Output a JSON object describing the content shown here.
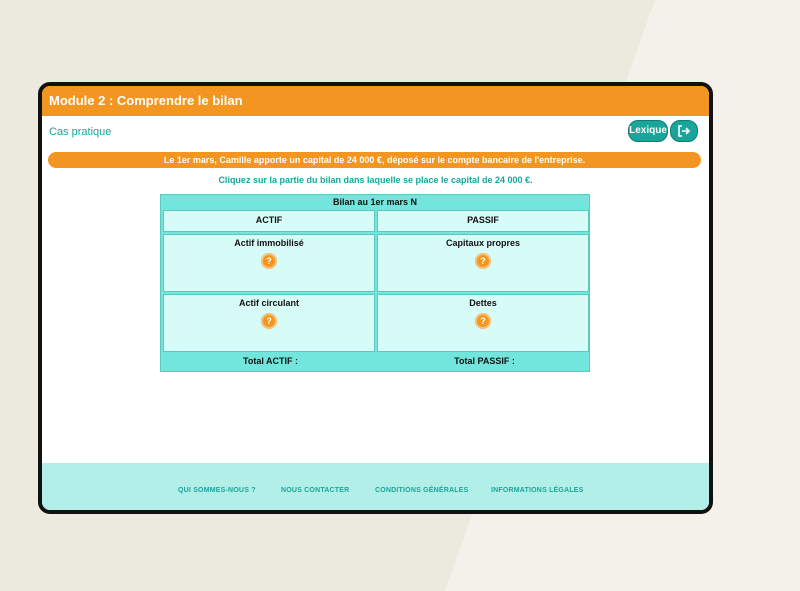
{
  "titlebar": {
    "title": "Module 2 : Comprendre le bilan"
  },
  "subheader": {
    "label": "Cas pratique"
  },
  "toolbar": {
    "lexique_label": "Lexique",
    "exit_icon": "exit-icon"
  },
  "banner": {
    "text": "Le 1er mars, Camille apporte un capital de 24 000 €, déposé sur le compte bancaire de l'entreprise."
  },
  "instruction": {
    "text": "Cliquez sur la partie du bilan dans laquelle se place le capital de 24 000 €."
  },
  "bilan": {
    "title": "Bilan au 1er mars N",
    "actif_header": "ACTIF",
    "passif_header": "PASSIF",
    "zones": {
      "actif_immobilise": "Actif immobilisé",
      "capitaux_propres": "Capitaux propres",
      "actif_circulant": "Actif circulant",
      "dettes": "Dettes"
    },
    "question_mark": "?",
    "total_actif": "Total ACTIF :",
    "total_passif": "Total PASSIF :"
  },
  "footer": {
    "links": [
      "QUI SOMMES-NOUS ?",
      "NOUS CONTACTER",
      "CONDITIONS GÉNÉRALES",
      "INFORMATIONS LÉGALES"
    ]
  },
  "colors": {
    "accent_orange": "#f39621",
    "accent_teal": "#1aa59b",
    "table_bg": "#72e6dc",
    "cell_bg": "#d7fbf7",
    "footer_bg": "#b2efe8"
  }
}
